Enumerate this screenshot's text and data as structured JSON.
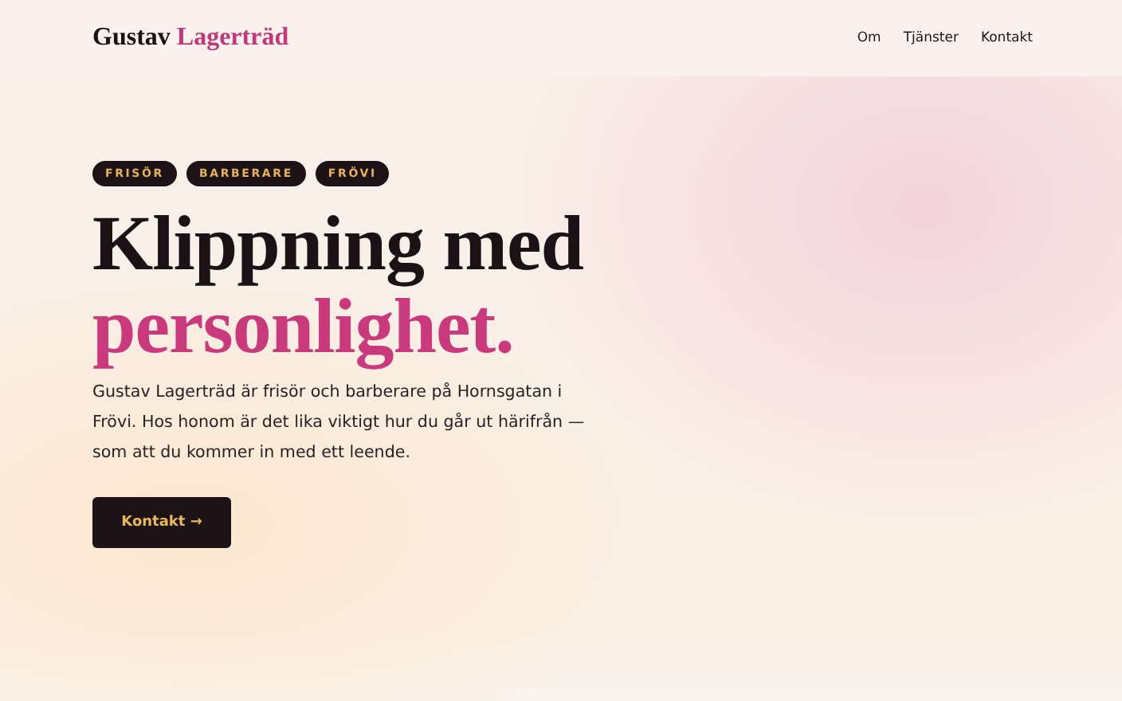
{
  "header": {
    "logo": {
      "first": "Gustav",
      "last": "Lagerträd"
    },
    "nav": [
      "Om",
      "Tjänster",
      "Kontakt"
    ]
  },
  "hero": {
    "tags": [
      "FRISÖR",
      "BARBERARE",
      "FRÖVI"
    ],
    "heading": {
      "line_1": "Klippning med",
      "line_2": "personlighet."
    },
    "text": "Gustav Lagerträd är frisör och barberare på Hornsgatan i Frövi. Hos honom är det lika viktigt hur du går ut härifrån — som att du kommer in med ett leende.",
    "button": "Kontakt →"
  }
}
